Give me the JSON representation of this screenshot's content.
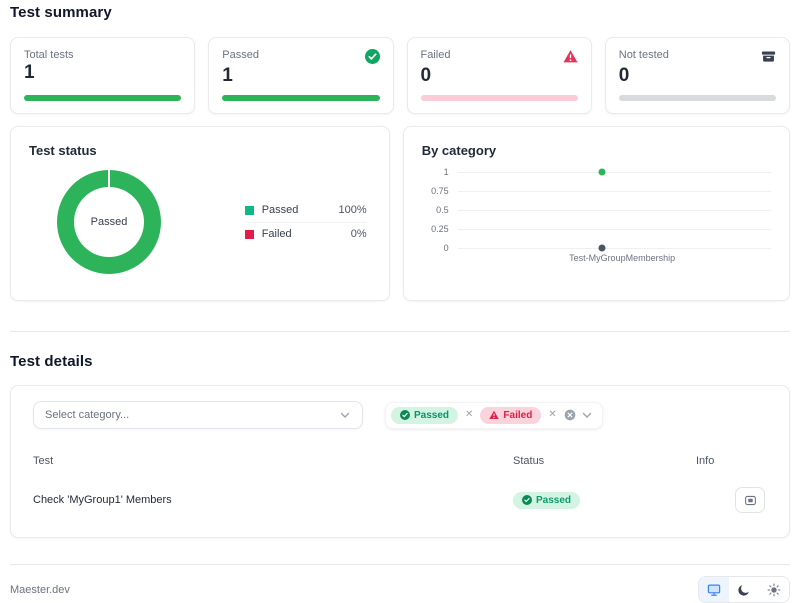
{
  "page": {
    "summary_title": "Test summary",
    "details_title": "Test details"
  },
  "summary_cards": [
    {
      "label": "Total tests",
      "value": "1",
      "icon": "none",
      "bar_color": "#2db45a"
    },
    {
      "label": "Passed",
      "value": "1",
      "icon": "check-circle-icon",
      "bar_color": "#2db45a"
    },
    {
      "label": "Failed",
      "value": "0",
      "icon": "alert-triangle-icon",
      "bar_color": "#f9ccd6"
    },
    {
      "label": "Not tested",
      "value": "0",
      "icon": "archive-icon",
      "bar_color": "#d8dbde"
    }
  ],
  "status_card": {
    "title": "Test status",
    "center_label": "Passed",
    "legend": [
      {
        "label": "Passed",
        "value": "100%",
        "color": "#10b981"
      },
      {
        "label": "Failed",
        "value": "0%",
        "color": "#e11d48"
      }
    ]
  },
  "category_card": {
    "title": "By category",
    "yticks": [
      "1",
      "0.75",
      "0.5",
      "0.25",
      "0"
    ],
    "x_label": "Test-MyGroupMembership"
  },
  "chart_data": [
    {
      "type": "pie",
      "title": "Test status",
      "labels": [
        "Passed",
        "Failed"
      ],
      "values": [
        100,
        0
      ],
      "unit": "%",
      "colors": [
        "#2db45a",
        "#e11d48"
      ],
      "center_label": "Passed",
      "legend_position": "right"
    },
    {
      "type": "scatter",
      "title": "By category",
      "categories": [
        "Test-MyGroupMembership"
      ],
      "series": [
        {
          "name": "Passed",
          "values": [
            1
          ],
          "color": "#2db45a"
        },
        {
          "name": "Failed",
          "values": [
            0
          ],
          "color": "#4b5563"
        }
      ],
      "ylim": [
        0,
        1
      ],
      "yticks": [
        1,
        0.75,
        0.5,
        0.25,
        0
      ],
      "grid": true
    }
  ],
  "details": {
    "select_placeholder": "Select category...",
    "filter_chips": [
      {
        "label": "Passed",
        "type": "passed"
      },
      {
        "label": "Failed",
        "type": "failed"
      }
    ],
    "table": {
      "headers": [
        "Test",
        "Status",
        "Info"
      ],
      "rows": [
        {
          "test": "Check 'MyGroup1' Members",
          "status": "Passed"
        }
      ]
    }
  },
  "footer": {
    "brand": "Maester.dev"
  },
  "colors": {
    "accent_green": "#2db45a",
    "legend_green": "#10b981",
    "rose": "#e11d48",
    "pill_green_bg": "#d3f3e3",
    "pill_pink_bg": "#fbd3dc",
    "bar_pink": "#f9ccd6",
    "bar_gray": "#d8dbde",
    "theme_blue": "#3b82f6"
  }
}
